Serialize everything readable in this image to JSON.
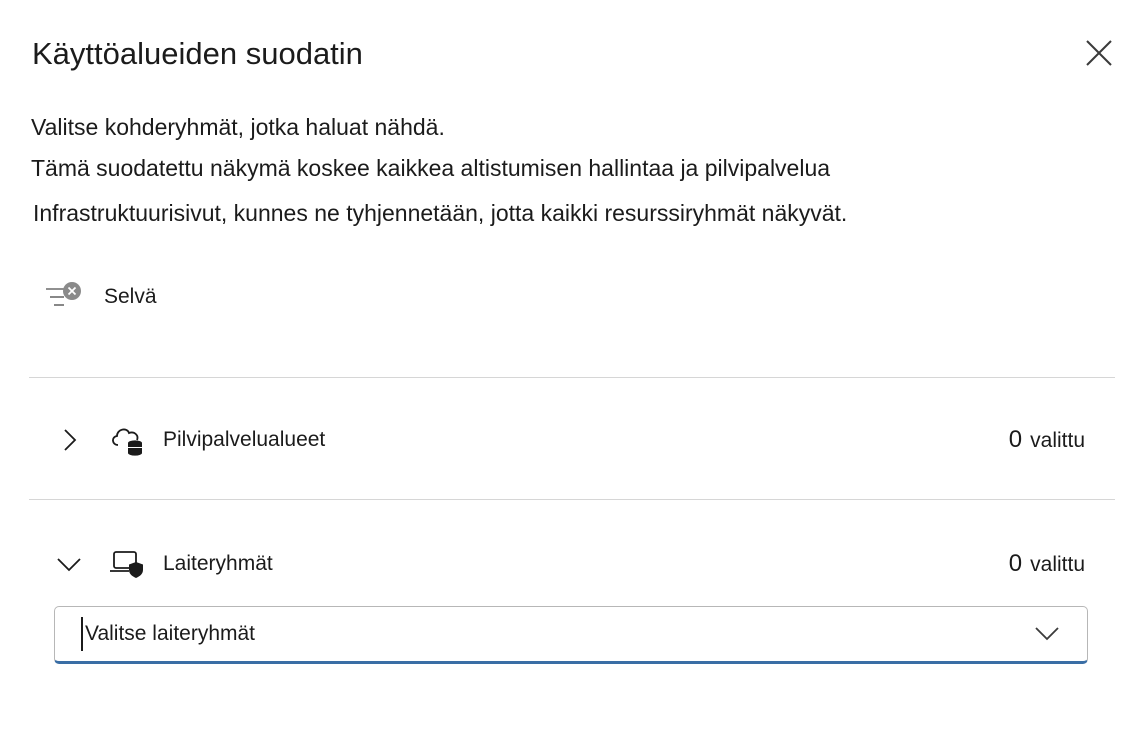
{
  "panel": {
    "title": "Käyttöalueiden suodatin",
    "close_icon": "close-icon"
  },
  "description": {
    "line1": "Valitse kohderyhmät, jotka haluat nähdä.",
    "line2": "Tämä suodatettu näkymä koskee kaikkea altistumisen hallintaa ja pilvipalvelua",
    "line3": "Infrastruktuurisivut, kunnes ne tyhjennetään, jotta kaikki resurssiryhmät näkyvät."
  },
  "clear": {
    "label": "Selvä",
    "icon": "clear-filter-icon"
  },
  "groups": [
    {
      "label": "Pilvipalvelualueet",
      "icon": "cloud-database-icon",
      "expanded": false,
      "count": "0",
      "count_label": "valittu"
    },
    {
      "label": "Laiteryhmät",
      "icon": "laptop-shield-icon",
      "expanded": true,
      "count": "0",
      "count_label": "valittu"
    }
  ],
  "device_select": {
    "placeholder": "Valitse laiteryhmät",
    "icon": "chevron-down-icon"
  },
  "colors": {
    "accent": "#3a6ea5",
    "divider": "#d6d6d6",
    "text": "#1b1b1b"
  }
}
